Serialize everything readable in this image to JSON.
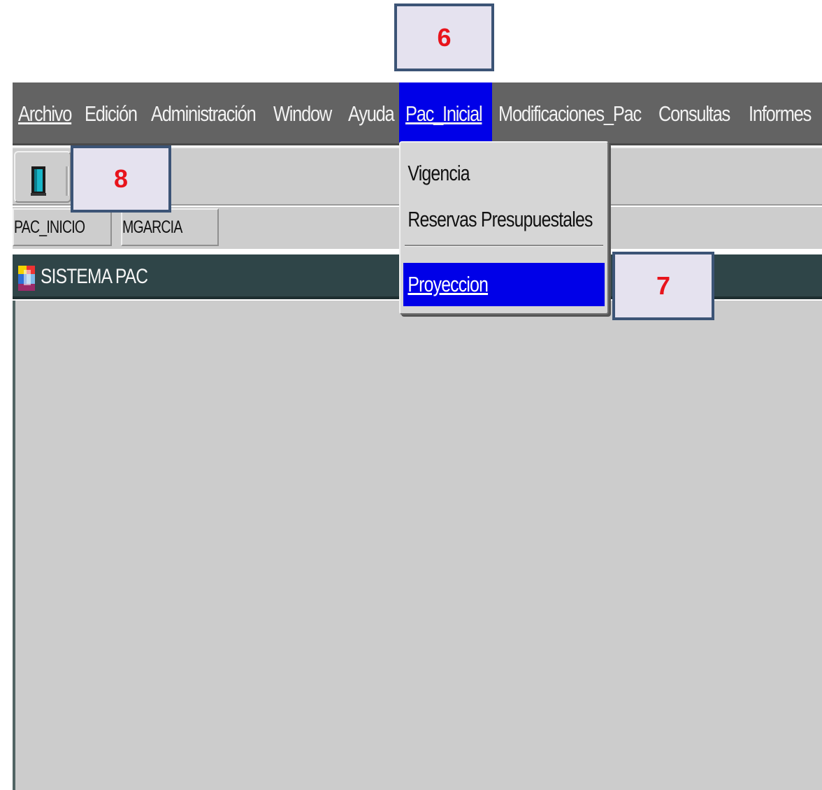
{
  "menubar": {
    "items": [
      {
        "label": "Archivo",
        "u": "A"
      },
      {
        "label": "Edición",
        "u": "E"
      },
      {
        "label": "Administración",
        "u": "A"
      },
      {
        "label": "Window",
        "u": ""
      },
      {
        "label": "Ayuda",
        "u": "A"
      },
      {
        "label": "Pac_Inicial",
        "u": "P",
        "active": true
      },
      {
        "label": "Modificaciones_Pac",
        "u": "M"
      },
      {
        "label": "Consultas",
        "u": "C"
      },
      {
        "label": "Informes",
        "u": "I"
      }
    ],
    "active_color": "#0000e8",
    "bg_color": "#636363"
  },
  "toolbar": {
    "exit_icon": "door-icon"
  },
  "status": {
    "form": "PAC_INICIO",
    "user": "MGARCIA"
  },
  "window": {
    "title": "SISTEMA PAC",
    "icon": "app-icon",
    "title_bg": "#2f4548"
  },
  "dropdown": {
    "items": [
      {
        "label": "Vigencia",
        "u": "V"
      },
      {
        "label": "Reservas Presupuestales",
        "u": "R"
      },
      {
        "label": "Proyeccion",
        "u": "",
        "active": true,
        "underline_all": true
      }
    ]
  },
  "callouts": {
    "c6": "6",
    "c7": "7",
    "c8": "8"
  }
}
